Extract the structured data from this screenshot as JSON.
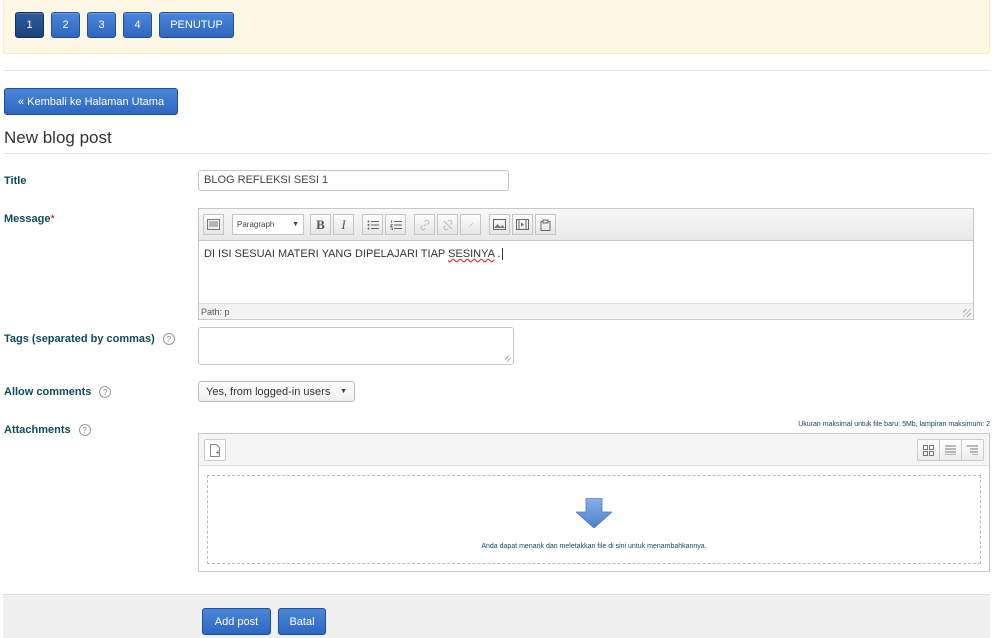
{
  "pager": {
    "pages": [
      "1",
      "2",
      "3",
      "4"
    ],
    "close_label": "PENUTUP"
  },
  "back_button_label": "« Kembali ke Halaman Utama",
  "page_title": "New blog post",
  "form": {
    "title_label": "Title",
    "title_value": "BLOG REFLEKSI SESI 1",
    "message_label": "Message",
    "required_mark": "*",
    "editor": {
      "format_select": "Paragraph",
      "content_before": "DI ISI SESUAI MATERI YANG DIPELAJARI TIAP ",
      "content_misspelled": "SESINYA",
      "content_after": " .",
      "path": "Path: p"
    },
    "tags_label": "Tags (separated by commas)",
    "allow_comments_label": "Allow comments",
    "allow_comments_value": "Yes, from logged-in users",
    "attachments_label": "Attachments",
    "max_size_text": "Ukuran maksimal untuk file baru: 5Mb, lampiran maksimum: 2",
    "drop_text": "Anda dapat menarik dan meletakkan file di sini untuk menambahkannya."
  },
  "footer": {
    "submit_label": "Add post",
    "cancel_label": "Batal"
  },
  "colors": {
    "primary": "#2f67c1",
    "notice_bg": "#fcf8e3",
    "label_text": "#0f4c5c",
    "required": "#cc0000"
  },
  "icons": [
    "toggle-toolbar-icon",
    "bold-icon",
    "italic-icon",
    "unordered-list-icon",
    "ordered-list-icon",
    "link-icon",
    "unlink-icon",
    "anchor-icon",
    "image-icon",
    "media-icon",
    "paste-icon",
    "help-icon",
    "add-file-icon",
    "icon-view-icon",
    "list-view-icon",
    "tree-view-icon",
    "drop-arrow-icon"
  ]
}
